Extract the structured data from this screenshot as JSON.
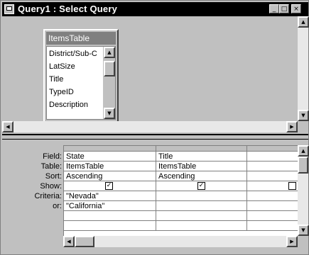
{
  "window": {
    "title": "Query1 : Select Query"
  },
  "table_box": {
    "title": "ItemsTable",
    "fields": [
      "District/Sub-C",
      "LatSize",
      "Title",
      "TypeID",
      "Description"
    ]
  },
  "grid": {
    "row_labels": [
      "Field:",
      "Table:",
      "Sort:",
      "Show:",
      "Criteria:",
      "or:"
    ],
    "columns": [
      {
        "field": "State",
        "table": "ItemsTable",
        "sort": "Ascending",
        "show": true,
        "criteria": "\"Nevada\"",
        "or": "\"California\""
      },
      {
        "field": "Title",
        "table": "ItemsTable",
        "sort": "Ascending",
        "show": true,
        "criteria": "",
        "or": ""
      },
      {
        "field": "",
        "table": "",
        "sort": "",
        "show": false,
        "criteria": "",
        "or": ""
      }
    ]
  },
  "icons": {
    "minimize": "minimize-icon",
    "maximize": "maximize-icon",
    "close": "close-icon",
    "check": "✓",
    "arrow_up": "▲",
    "arrow_down": "▼",
    "arrow_left": "◀",
    "arrow_right": "▶"
  }
}
